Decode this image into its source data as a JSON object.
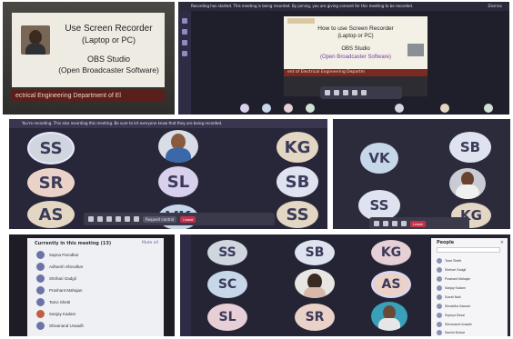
{
  "panels": {
    "p1": {
      "slide_line1": "Use Screen Recorder",
      "slide_line2": "(Laptop or PC)",
      "slide_line3": "OBS Studio",
      "slide_line4": "(Open Broadcaster Software)",
      "footer": "ectrical Engineering Department of El"
    },
    "p2": {
      "notice": "Recording has started. This meeting is being recorded. By joining, you are giving consent for this meeting to be recorded.",
      "dismiss": "Dismiss",
      "slide_line1": "How to use Screen Recorder",
      "slide_line2": "(Laptop or PC)",
      "slide_line3": "OBS Studio",
      "slide_line4": "(Open Broadcaster Software)",
      "footer": "ent of Electrical Engineering Departm"
    },
    "p3": {
      "notice": "You're recording. This also recording this meeting. Be sure to let everyone know that they are being recorded.",
      "tiles": [
        "SS",
        "SR",
        "AS",
        "SL",
        "VK",
        "KG",
        "SB",
        "SS"
      ],
      "leave": "Leave",
      "request_control": "Request control"
    },
    "p4": {
      "tiles": [
        "VK",
        "SB",
        "SS",
        "KG"
      ]
    },
    "p5": {
      "title": "Currently in this meeting (13)",
      "mute_all": "Mute all",
      "names": [
        "Sapna Parodkar",
        "Adharsh Shirodkar",
        "Shrihari Gadgil",
        "Prashant Mahajan",
        "Tanvi Shetti",
        "Sanjay Kadam",
        "Shivanand Uvaadh"
      ]
    },
    "p6": {
      "tiles": [
        "SS",
        "SB",
        "KG",
        "SC",
        "AS",
        "SL",
        "SR"
      ],
      "people_title": "People",
      "names": [
        "Tanvi Shetti",
        "Shrihari Gadgil",
        "Prashant Mahajan",
        "Sanjay Kadam",
        "Sonali Naik",
        "Shraddha Sawant",
        "Supriya Desai",
        "Shivanand Uvaadh",
        "Sachin Borkar"
      ]
    }
  },
  "colors": {
    "teams_dark": "#292840",
    "accent": "#6264a7",
    "leave_red": "#c4314b"
  }
}
